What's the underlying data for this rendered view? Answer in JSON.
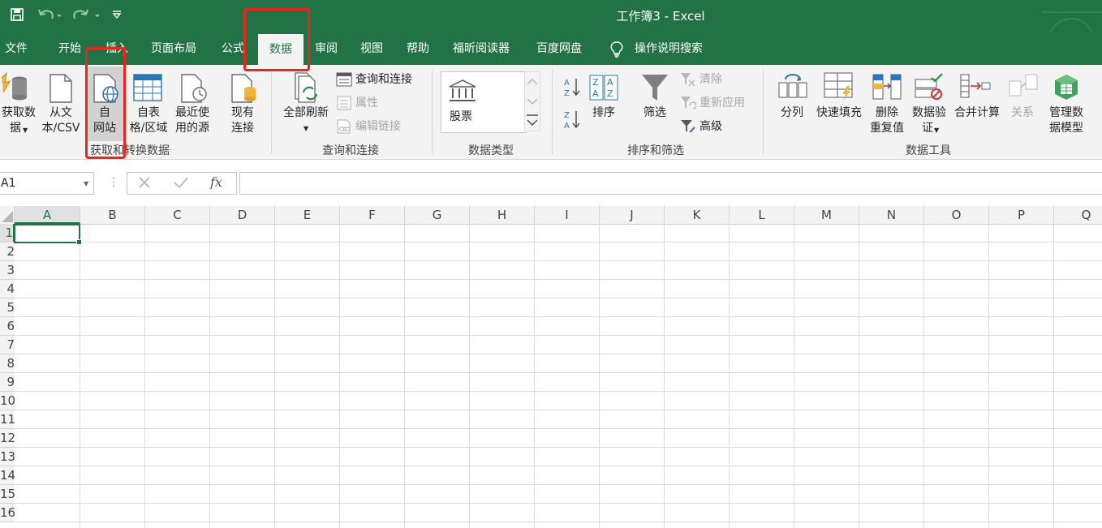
{
  "window": {
    "title": "工作簿3  -  Excel"
  },
  "qat": {
    "save_icon": "save-icon",
    "undo_icon": "undo-icon",
    "redo_icon": "redo-icon",
    "customize_icon": "customize-icon"
  },
  "tabs": [
    {
      "label": "文件"
    },
    {
      "label": "开始"
    },
    {
      "label": "插入"
    },
    {
      "label": "页面布局"
    },
    {
      "label": "公式"
    },
    {
      "label": "数据"
    },
    {
      "label": "审阅"
    },
    {
      "label": "视图"
    },
    {
      "label": "帮助"
    },
    {
      "label": "福昕阅读器"
    },
    {
      "label": "百度网盘"
    }
  ],
  "tell_me": {
    "label": "操作说明搜索"
  },
  "ribbon": {
    "get_data": {
      "line1": "获取数",
      "line2": "据"
    },
    "from_text": {
      "line1": "从文",
      "line2": "本/CSV"
    },
    "from_web": {
      "line1": "自",
      "line2": "网站"
    },
    "from_table": {
      "line1": "自表",
      "line2": "格/区域"
    },
    "recent_sources": {
      "line1": "最近使",
      "line2": "用的源"
    },
    "existing_connections": {
      "line1": "现有",
      "line2": "连接"
    },
    "group_get_transform": "获取和转换数据",
    "refresh_all": {
      "line1": "全部刷新"
    },
    "queries_connections": "查询和连接",
    "properties": "属性",
    "edit_links": "编辑链接",
    "group_queries": "查询和连接",
    "stocks": "股票",
    "group_datatypes": "数据类型",
    "sort": "排序",
    "filter": "筛选",
    "clear": "清除",
    "reapply": "重新应用",
    "advanced": "高级",
    "group_sort_filter": "排序和筛选",
    "text_to_columns": "分列",
    "flash_fill": "快速填充",
    "remove_dup": {
      "line1": "删除",
      "line2": "重复值"
    },
    "data_validation": {
      "line1": "数据验",
      "line2": "证"
    },
    "consolidate": "合并计算",
    "relationships": "关系",
    "manage_model": {
      "line1": "管理数",
      "line2": "据模型"
    },
    "group_data_tools": "数据工具"
  },
  "formula_bar": {
    "name_box": "A1",
    "fx": "fx",
    "value": ""
  },
  "columns": [
    "A",
    "B",
    "C",
    "D",
    "E",
    "F",
    "G",
    "H",
    "I",
    "J",
    "K",
    "L",
    "M",
    "N",
    "O",
    "P",
    "Q"
  ],
  "rows": [
    "1",
    "2",
    "3",
    "4",
    "5",
    "6",
    "7",
    "8",
    "9",
    "10",
    "11",
    "12",
    "13",
    "14",
    "15",
    "16"
  ],
  "selected_cell": "A1",
  "colors": {
    "excel_green": "#217346",
    "highlight_red": "#e8261d"
  }
}
